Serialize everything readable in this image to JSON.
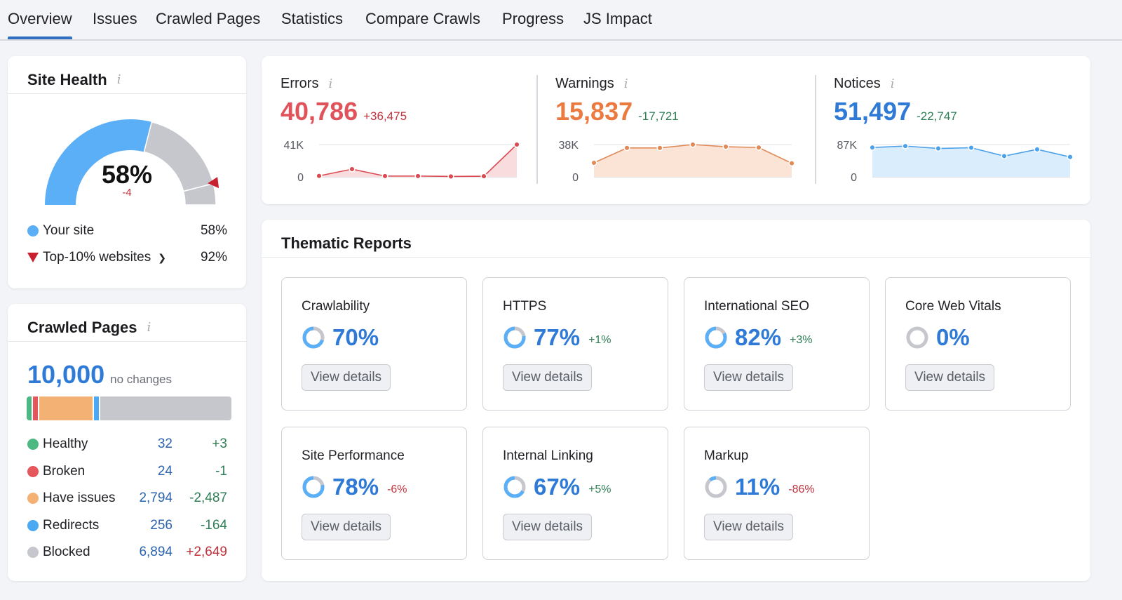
{
  "tabs": [
    {
      "label": "Overview",
      "active": true
    },
    {
      "label": "Issues",
      "active": false
    },
    {
      "label": "Crawled Pages",
      "active": false
    },
    {
      "label": "Statistics",
      "active": false
    },
    {
      "label": "Compare Crawls",
      "active": false
    },
    {
      "label": "Progress",
      "active": false
    },
    {
      "label": "JS Impact",
      "active": false
    }
  ],
  "site_health": {
    "title": "Site Health",
    "info_icon": "i",
    "score": "58%",
    "score_value": 58,
    "benchmark_value": 92,
    "delta": "-4",
    "legend": [
      {
        "label": "Your site",
        "value": "58%",
        "marker": "dot",
        "color": "#5aaff6"
      },
      {
        "label": "Top-10% websites",
        "value": "92%",
        "marker": "triangle-down",
        "color": "#c8202e",
        "dropdown": true
      }
    ],
    "colors": {
      "fill": "#5aaff6",
      "track": "#c5c7cd",
      "marker": "#c8202e"
    }
  },
  "crawled_pages": {
    "title": "Crawled Pages",
    "info_icon": "i",
    "total": "10,000",
    "total_note": "no changes",
    "rows": [
      {
        "label": "Healthy",
        "count": "32",
        "change": "+3",
        "change_tone": "good",
        "color": "#4bb981",
        "share": 0.9
      },
      {
        "label": "Broken",
        "count": "24",
        "change": "-1",
        "change_tone": "good",
        "color": "#e5575c",
        "share": 0.9
      },
      {
        "label": "Have issues",
        "count": "2,794",
        "change": "-2,487",
        "change_tone": "good",
        "color": "#f3b174",
        "share": 27.94
      },
      {
        "label": "Redirects",
        "count": "256",
        "change": "-164",
        "change_tone": "good",
        "color": "#4ba8f2",
        "share": 2.56
      },
      {
        "label": "Blocked",
        "count": "6,894",
        "change": "+2,649",
        "change_tone": "bad",
        "color": "#c5c7cd",
        "share": 68.94
      }
    ]
  },
  "stats": [
    {
      "title": "Errors",
      "info_icon": "i",
      "value": "40,786",
      "delta": "+36,475",
      "delta_tone": "bad",
      "color": "#e0535a",
      "fill": "#f9dcdd",
      "dot": "#d94a52",
      "y_max_label": "41K",
      "y_min_label": "0",
      "y_max": 41000,
      "series": [
        1200,
        9800,
        1000,
        1000,
        500,
        800,
        41000
      ]
    },
    {
      "title": "Warnings",
      "info_icon": "i",
      "value": "15,837",
      "delta": "-17,721",
      "delta_tone": "good",
      "color": "#eb7a40",
      "fill": "#fbe3d6",
      "dot": "#e08a57",
      "y_max_label": "38K",
      "y_min_label": "0",
      "y_max": 38000,
      "series": [
        16500,
        34000,
        34000,
        38000,
        35500,
        34500,
        16000
      ]
    },
    {
      "title": "Notices",
      "info_icon": "i",
      "value": "51,497",
      "delta": "-22,747",
      "delta_tone": "good",
      "color": "#2e7ad6",
      "fill": "#daedfc",
      "dot": "#4ba0ea",
      "y_max_label": "87K",
      "y_min_label": "0",
      "y_max": 87000,
      "series": [
        79000,
        83000,
        76500,
        78500,
        56000,
        74000,
        53500
      ]
    }
  ],
  "thematic": {
    "title": "Thematic Reports",
    "button_label": "View details",
    "reports": [
      {
        "title": "Crawlability",
        "percent": "70%",
        "value": 70,
        "delta": "",
        "delta_tone": ""
      },
      {
        "title": "HTTPS",
        "percent": "77%",
        "value": 77,
        "delta": "+1%",
        "delta_tone": "good"
      },
      {
        "title": "International SEO",
        "percent": "82%",
        "value": 82,
        "delta": "+3%",
        "delta_tone": "good"
      },
      {
        "title": "Core Web Vitals",
        "percent": "0%",
        "value": 0,
        "delta": "",
        "delta_tone": ""
      },
      {
        "title": "Site Performance",
        "percent": "78%",
        "value": 78,
        "delta": "-6%",
        "delta_tone": "bad"
      },
      {
        "title": "Internal Linking",
        "percent": "67%",
        "value": 67,
        "delta": "+5%",
        "delta_tone": "good"
      },
      {
        "title": "Markup",
        "percent": "11%",
        "value": 11,
        "delta": "-86%",
        "delta_tone": "bad"
      }
    ]
  },
  "colors": {
    "accent": "#2e7ad6",
    "tab_underline": "#2e6fc4",
    "positive": "#2e7d55",
    "negative": "#c0323d",
    "ring_fill": "#5aaff6",
    "ring_track": "#c5c7cd"
  }
}
